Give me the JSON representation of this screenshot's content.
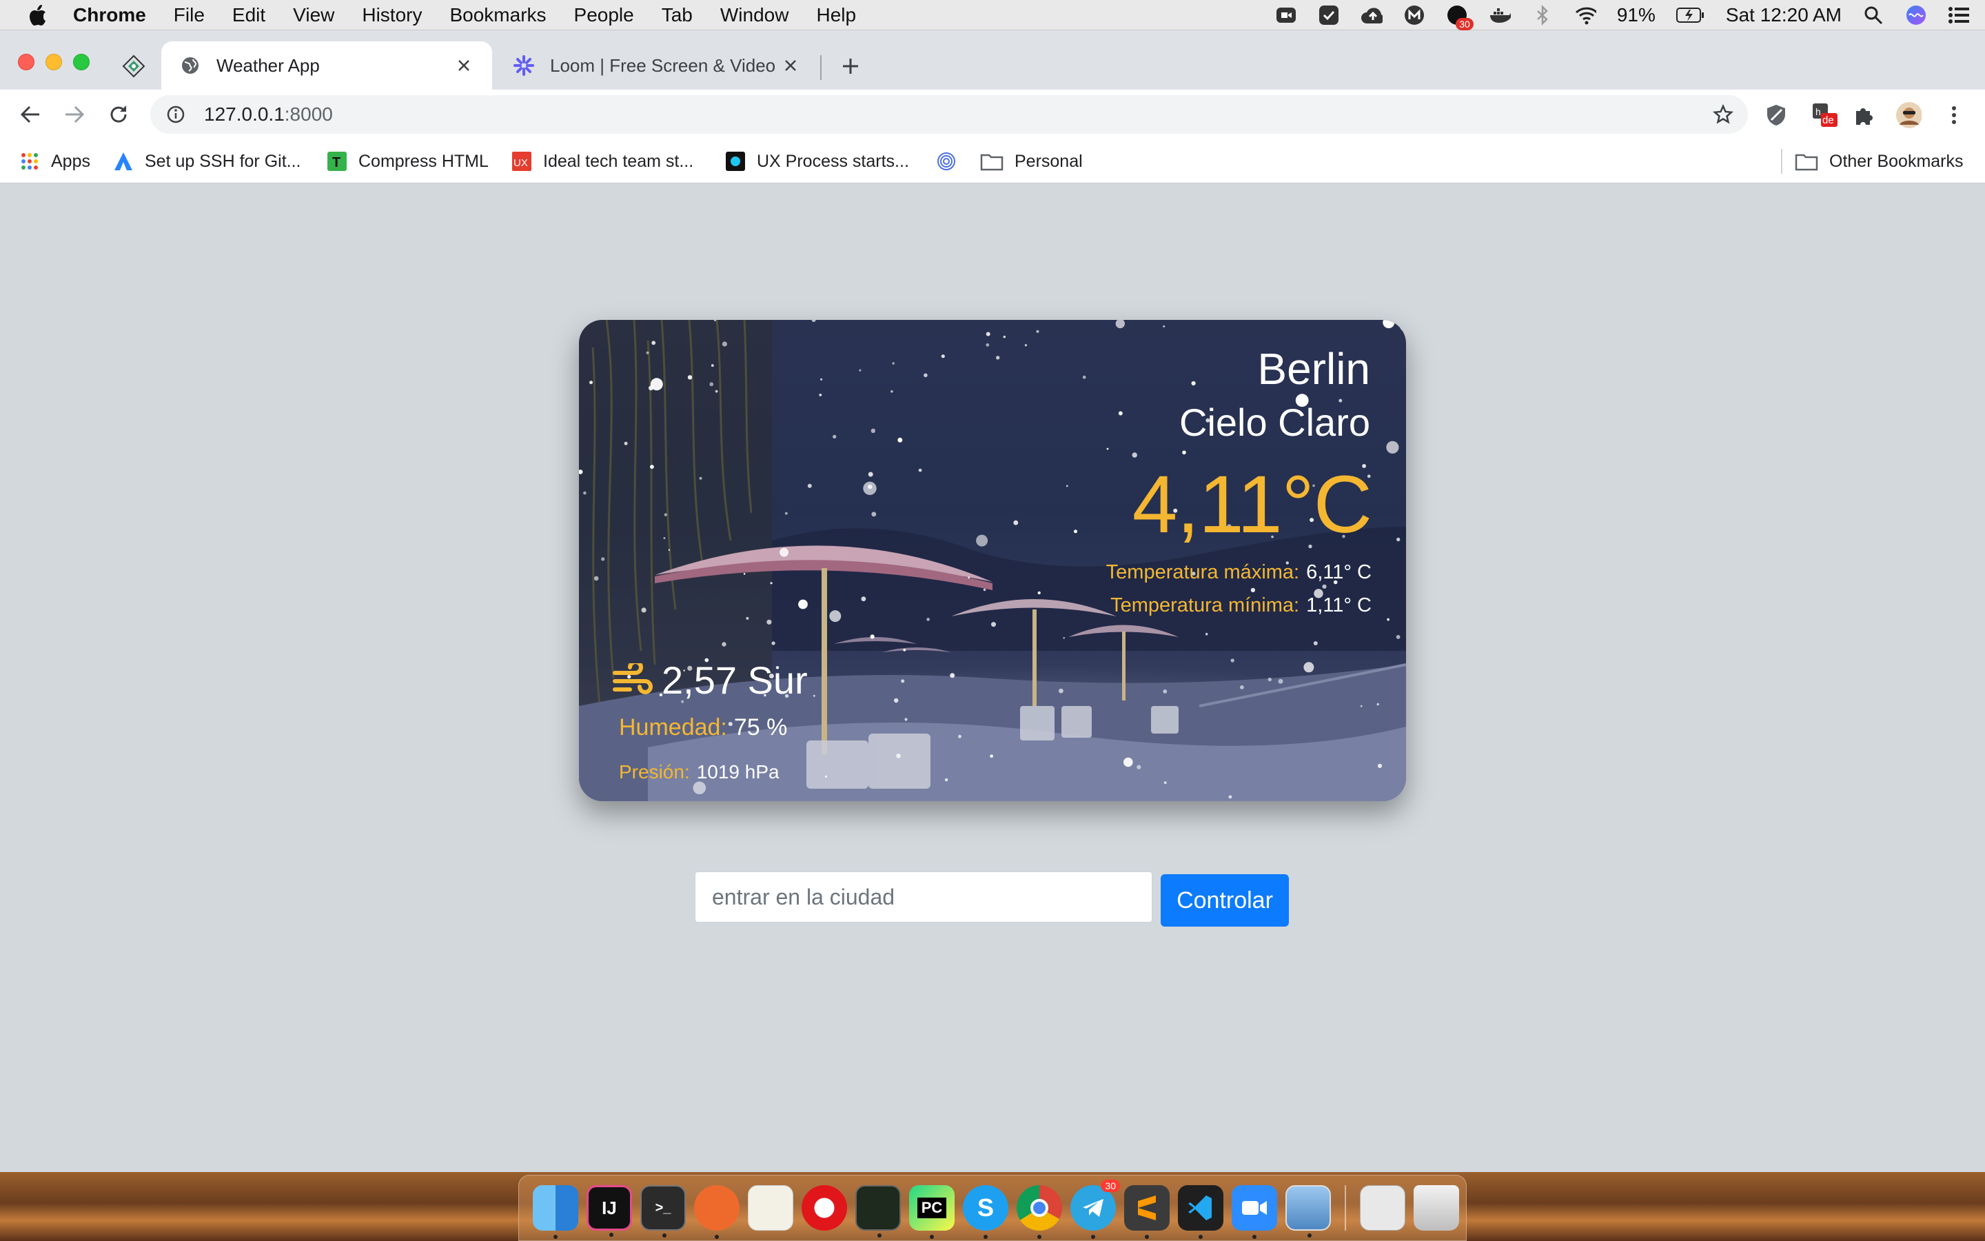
{
  "menubar": {
    "app_name": "Chrome",
    "items": [
      "File",
      "Edit",
      "View",
      "History",
      "Bookmarks",
      "People",
      "Tab",
      "Window",
      "Help"
    ],
    "battery": "91%",
    "clock": "Sat 12:20 AM",
    "notification_badge": "30"
  },
  "tabs": [
    {
      "title": "Weather App",
      "active": true
    },
    {
      "title": "Loom | Free Screen & Video Re",
      "active": false
    }
  ],
  "address_bar": {
    "host": "127.0.0.1",
    "port": ":8000"
  },
  "bookmarks": {
    "items": [
      "Apps",
      "Set up SSH for Git...",
      "Compress HTML",
      "Ideal tech team st...",
      "UX Process starts...",
      "Personal"
    ],
    "other": "Other Bookmarks"
  },
  "extension_badge": "de",
  "weather": {
    "city": "Berlin",
    "description": "Cielo Claro",
    "temperature": "4,11°C",
    "max_label": "Temperatura máxima:",
    "max_value": "6,11° C",
    "min_label": "Temperatura mínima:",
    "min_value": "1,11° C",
    "wind": "2,57 Sur",
    "humidity_label": "Humedad:",
    "humidity_value": "75 %",
    "pressure_label": "Presión:",
    "pressure_value": "1019 hPa"
  },
  "search": {
    "placeholder": "entrar en la ciudad",
    "button_label": "Controlar"
  },
  "dock": {
    "telegram_badge": "30",
    "apps": [
      "Finder",
      "IntelliJ IDEA",
      "Terminal",
      "Paw",
      "TextEdit",
      "Opera",
      "Activity Monitor",
      "PyCharm",
      "Skype",
      "Chrome",
      "Telegram",
      "Sublime Text",
      "VS Code",
      "Zoom",
      "Preview",
      "Documents",
      "Trash"
    ]
  }
}
